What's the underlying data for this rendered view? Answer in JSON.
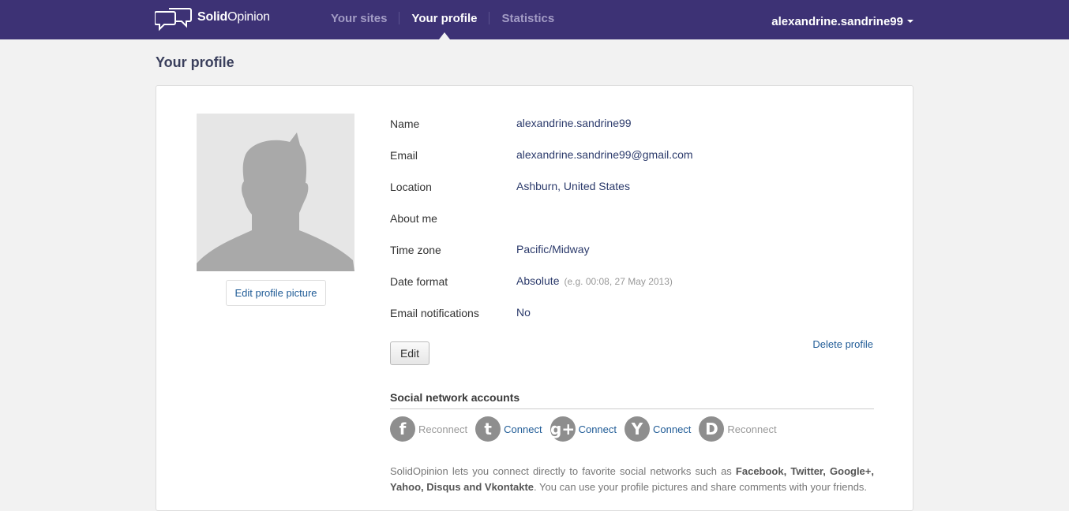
{
  "header": {
    "logo_bold": "Solid",
    "logo_rest": "Opinion",
    "nav": [
      {
        "label": "Your sites",
        "active": false
      },
      {
        "label": "Your profile",
        "active": true
      },
      {
        "label": "Statistics",
        "active": false
      }
    ],
    "username": "alexandrine.sandrine99"
  },
  "page_title": "Your profile",
  "profile": {
    "edit_picture_label": "Edit profile picture",
    "fields": [
      {
        "label": "Name",
        "value": "alexandrine.sandrine99"
      },
      {
        "label": "Email",
        "value": "alexandrine.sandrine99@gmail.com"
      },
      {
        "label": "Location",
        "value": "Ashburn, United States"
      },
      {
        "label": "About me",
        "value": ""
      },
      {
        "label": "Time zone",
        "value": "Pacific/Midway"
      },
      {
        "label": "Date format",
        "value": "Absolute",
        "hint": "(e.g. 00:08, 27 May 2013)"
      },
      {
        "label": "Email notifications",
        "value": "No"
      }
    ],
    "edit_label": "Edit",
    "delete_label": "Delete profile"
  },
  "social": {
    "title": "Social network accounts",
    "accounts": [
      {
        "icon": "facebook-icon",
        "glyph": "f",
        "action": "Reconnect",
        "connected": true
      },
      {
        "icon": "twitter-icon",
        "glyph": "t",
        "action": "Connect",
        "connected": false
      },
      {
        "icon": "google-plus-icon",
        "glyph": "g+",
        "action": "Connect",
        "connected": false
      },
      {
        "icon": "yahoo-icon",
        "glyph": "Y",
        "action": "Connect",
        "connected": false
      },
      {
        "icon": "disqus-icon",
        "glyph": "D",
        "action": "Reconnect",
        "connected": true
      }
    ],
    "info_pre": "SolidOpinion lets you connect directly to favorite social networks such as ",
    "info_bold": "Facebook, Twitter, Google+, Yahoo, Disqus and Vkontakte",
    "info_post": ". You can use your profile pictures and share comments with your friends."
  },
  "colors": {
    "header_bg": "#3d3275",
    "link": "#1f5b96",
    "value_text": "#2b3a6b"
  }
}
